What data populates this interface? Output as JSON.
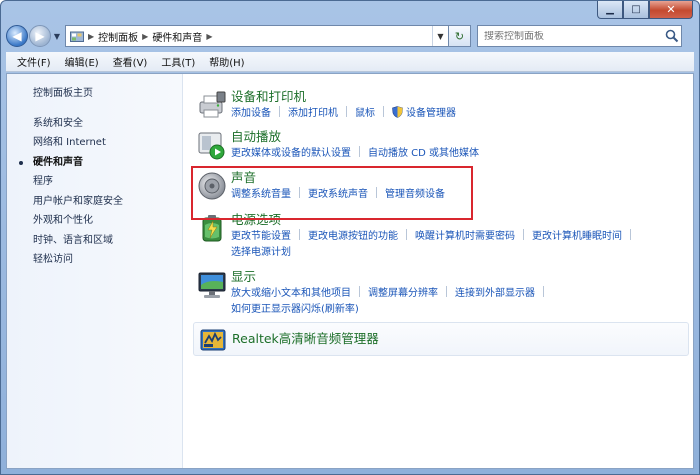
{
  "window": {
    "caption": {
      "minimize": "▁",
      "maximize": "□",
      "close": "✕"
    }
  },
  "nav": {
    "breadcrumbs": [
      "控制面板",
      "硬件和声音"
    ],
    "search_placeholder": "搜索控制面板",
    "back_glyph": "◀",
    "forward_glyph": "▶",
    "refresh_glyph": "↻",
    "dropdown_glyph": "▼",
    "separator_glyph": "▶"
  },
  "menu": {
    "items": [
      "文件(F)",
      "编辑(E)",
      "查看(V)",
      "工具(T)",
      "帮助(H)"
    ]
  },
  "left_pane": {
    "home": "控制面板主页",
    "items": [
      "系统和安全",
      "网络和 Internet",
      "硬件和声音",
      "程序",
      "用户帐户和家庭安全",
      "外观和个性化",
      "时钟、语言和区域",
      "轻松访问"
    ],
    "active_index": 2
  },
  "categories": {
    "devices": {
      "title": "设备和打印机",
      "links": [
        "添加设备",
        "添加打印机",
        "鼠标",
        "设备管理器"
      ]
    },
    "autoplay": {
      "title": "自动播放",
      "links": [
        "更改媒体或设备的默认设置",
        "自动播放 CD 或其他媒体"
      ]
    },
    "sound": {
      "title": "声音",
      "links": [
        "调整系统音量",
        "更改系统声音",
        "管理音频设备"
      ]
    },
    "power": {
      "title": "电源选项",
      "links": [
        "更改节能设置",
        "更改电源按钮的功能",
        "唤醒计算机时需要密码",
        "更改计算机睡眠时间",
        "选择电源计划"
      ]
    },
    "display": {
      "title": "显示",
      "links": [
        "放大或缩小文本和其他项目",
        "调整屏幕分辨率",
        "连接到外部显示器",
        "如何更正显示器闪烁(刷新率)"
      ]
    },
    "realtek": {
      "title": "Realtek高清晰音频管理器"
    }
  },
  "colors": {
    "category_title": "#1d6f2a",
    "link": "#1a55b8",
    "highlight": "#d9262e"
  }
}
